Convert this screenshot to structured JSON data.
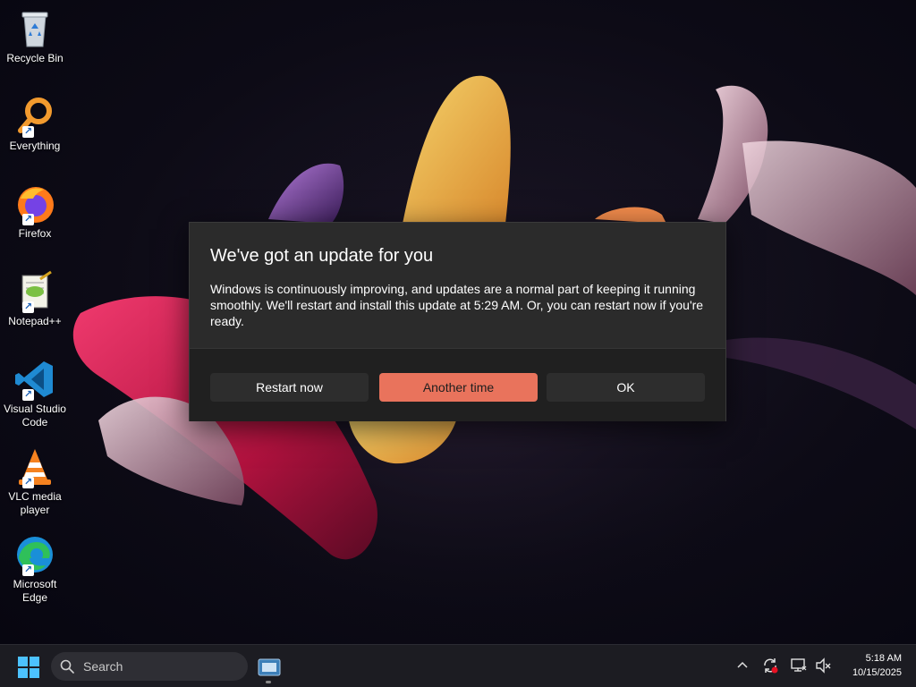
{
  "desktop": {
    "icons": [
      {
        "label": "Recycle Bin",
        "icon": "recycle-bin-icon",
        "shortcut": false
      },
      {
        "label": "Everything",
        "icon": "everything-search-icon",
        "shortcut": true
      },
      {
        "label": "Firefox",
        "icon": "firefox-icon",
        "shortcut": true
      },
      {
        "label": "Notepad++",
        "icon": "notepad-plus-plus-icon",
        "shortcut": true
      },
      {
        "label": "Visual Studio Code",
        "icon": "vscode-icon",
        "shortcut": true
      },
      {
        "label": "VLC media player",
        "icon": "vlc-icon",
        "shortcut": true
      },
      {
        "label": "Microsoft Edge",
        "icon": "edge-icon",
        "shortcut": true
      }
    ],
    "shortcut_arrow": "↗"
  },
  "dialog": {
    "title": "We've got an update for you",
    "body": "Windows is continuously improving, and updates are a normal part of keeping it running smoothly. We'll restart and install this update at 5:29 AM. Or, you can restart now if you're ready.",
    "buttons": {
      "restart": "Restart now",
      "another": "Another time",
      "ok": "OK"
    },
    "accent_color": "#e9735c"
  },
  "taskbar": {
    "search_label": "Search",
    "clock": {
      "time": "5:18 AM",
      "date": "10/15/2025"
    },
    "tray_icons": [
      "chevron-up-icon",
      "update-sync-icon",
      "display-network-icon",
      "speaker-muted-icon"
    ]
  }
}
